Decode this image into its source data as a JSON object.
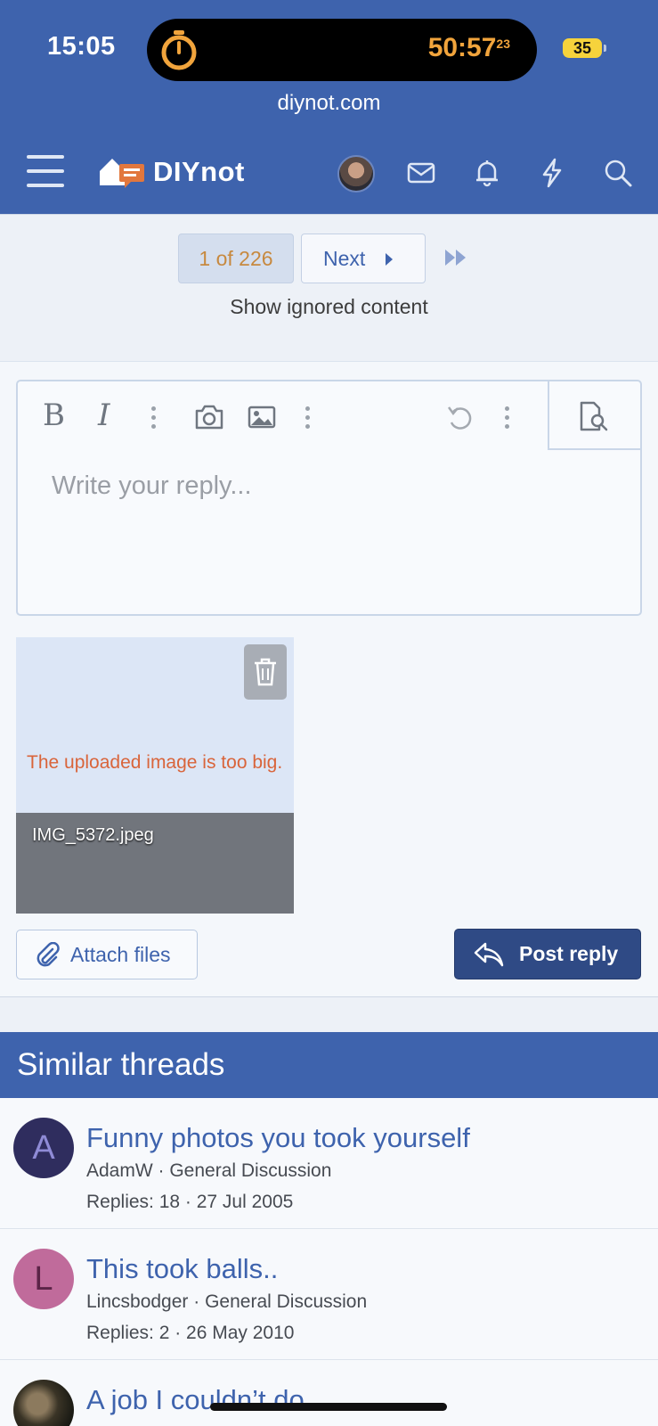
{
  "status_bar": {
    "time": "15:05",
    "timer": "50:57",
    "timer_fraction": "23",
    "battery": "35"
  },
  "browser": {
    "url": "diynot.com"
  },
  "site": {
    "logo_text": "DIYnot"
  },
  "pagination": {
    "current": "1 of 226",
    "next_label": "Next",
    "show_ignored": "Show ignored content"
  },
  "editor": {
    "bold_label": "B",
    "italic_label": "I",
    "placeholder": "Write your reply..."
  },
  "attachment": {
    "error": "The uploaded image is too big.",
    "filename": "IMG_5372.jpeg"
  },
  "actions": {
    "attach_label": "Attach files",
    "post_label": "Post reply"
  },
  "similar": {
    "heading": "Similar threads",
    "threads": [
      {
        "initial": "A",
        "avatar_color": "#2f2d5e",
        "initial_color": "#8f8bd6",
        "title": "Funny photos you took yourself",
        "meta": "AdamW · General Discussion",
        "stats": "Replies: 18 · 27 Jul 2005"
      },
      {
        "initial": "L",
        "avatar_color": "#c06b9b",
        "initial_color": "#5b2447",
        "title": "This took balls..",
        "meta": "Lincsbodger · General Discussion",
        "stats": "Replies: 2 · 26 May 2010"
      },
      {
        "initial": "",
        "title": "A job I couldn’t do",
        "meta": "",
        "stats": ""
      }
    ]
  },
  "colors": {
    "brand_blue": "#3e63ad",
    "post_button": "#2f4a85",
    "error": "#d9643a",
    "timer": "#f1a43c"
  }
}
